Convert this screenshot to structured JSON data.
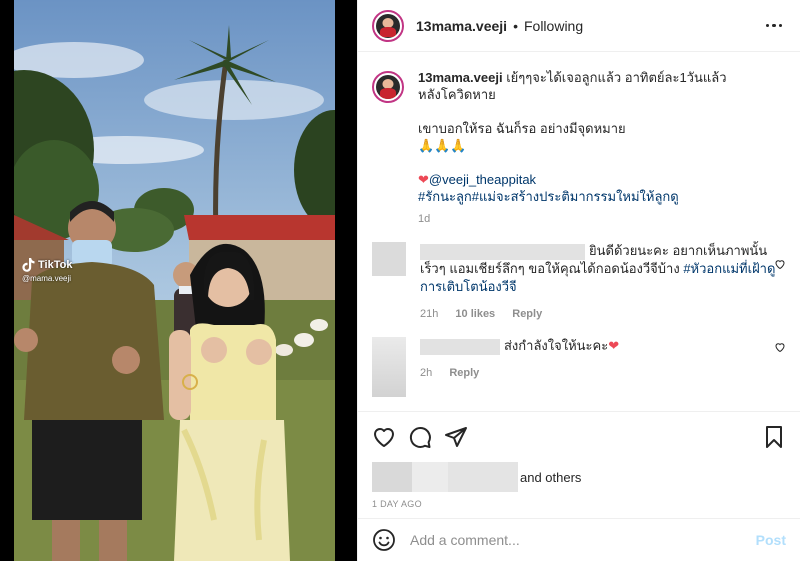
{
  "media": {
    "watermark_brand": "TikTok",
    "watermark_handle": "@mama.veeji"
  },
  "header": {
    "username": "13mama.veeji",
    "separator": "•",
    "follow_status": "Following"
  },
  "caption": {
    "username": "13mama.veeji",
    "line1": "เย้ๆๆจะได้เจอลูกแล้ว อาทิตย์ละ1วันแล้ว",
    "line2": "หลังโควิดหาย",
    "line3": "เขาบอกให้รอ ฉันก็รอ อย่างมีจุดหมาย",
    "emoji": "🙏🙏🙏",
    "heart": "❤",
    "mention": "@veeji_theappitak",
    "hashtags": "#รักนะลูก#แม่จะสร้างประติมากรรมใหม่ให้ลูกดู",
    "time": "1d"
  },
  "comments": [
    {
      "text_part1": "ยินดีด้วยนะคะ อยากเห็นภาพนั้นเร็วๆ แอมเชียร์ลึกๆ ขอให้คุณได้กอดน้องวีจีบ้าง",
      "hashtag": "#หัวอกแม่ที่เฝ้าดูการเติบโตน้องวีจี",
      "time": "21h",
      "likes": "10 likes",
      "reply": "Reply"
    },
    {
      "text": "ส่งกำลังใจให้นะคะ",
      "heart": "❤",
      "time": "2h",
      "reply": "Reply"
    }
  ],
  "actions": {
    "likes_suffix": "and others",
    "posted_ago": "1 DAY AGO"
  },
  "add_comment": {
    "placeholder": "Add a comment...",
    "post_label": "Post"
  },
  "colors": {
    "link": "#00376b",
    "meta_gray": "#8e8e8e",
    "post_disabled": "#b2dffc",
    "heart": "#ed4956"
  }
}
